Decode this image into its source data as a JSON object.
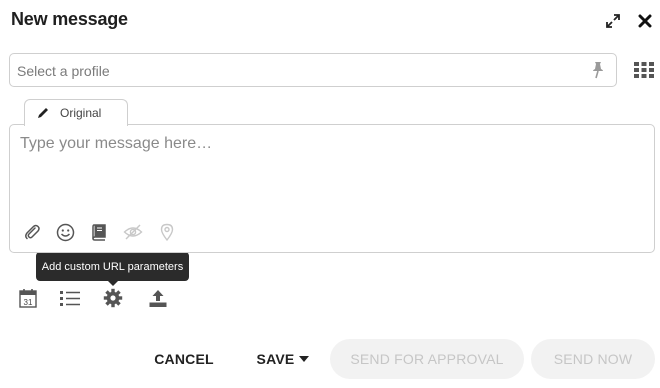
{
  "header": {
    "title": "New message",
    "expand_icon": "expand-arrows-icon",
    "close_icon": "close-x-icon"
  },
  "profile": {
    "placeholder": "Select a profile",
    "pin_icon": "pin-icon",
    "grid_icon": "grid-icon"
  },
  "tab": {
    "label": "Original",
    "icon": "pencil-icon"
  },
  "message": {
    "placeholder": "Type your message here…",
    "tools": [
      "paperclip-icon",
      "smiley-icon",
      "book-icon",
      "eye-slash-icon",
      "map-pin-icon"
    ]
  },
  "tooltip": {
    "text": "Add custom URL parameters"
  },
  "options": {
    "calendar_day": "31",
    "icons": [
      "calendar-icon",
      "list-icon",
      "gear-icon",
      "upload-icon"
    ]
  },
  "footer": {
    "cancel_label": "CANCEL",
    "save_label": "SAVE",
    "approval_label": "SEND FOR APPROVAL",
    "send_label": "SEND NOW"
  },
  "colors": {
    "text_dark": "#1f1f1f",
    "border": "#cfcfcf",
    "tooltip_bg": "#2b2b2b",
    "disabled_bg": "#f2f2f2",
    "disabled_text": "#c6c6c6",
    "icon_muted": "#c8c8c8"
  }
}
